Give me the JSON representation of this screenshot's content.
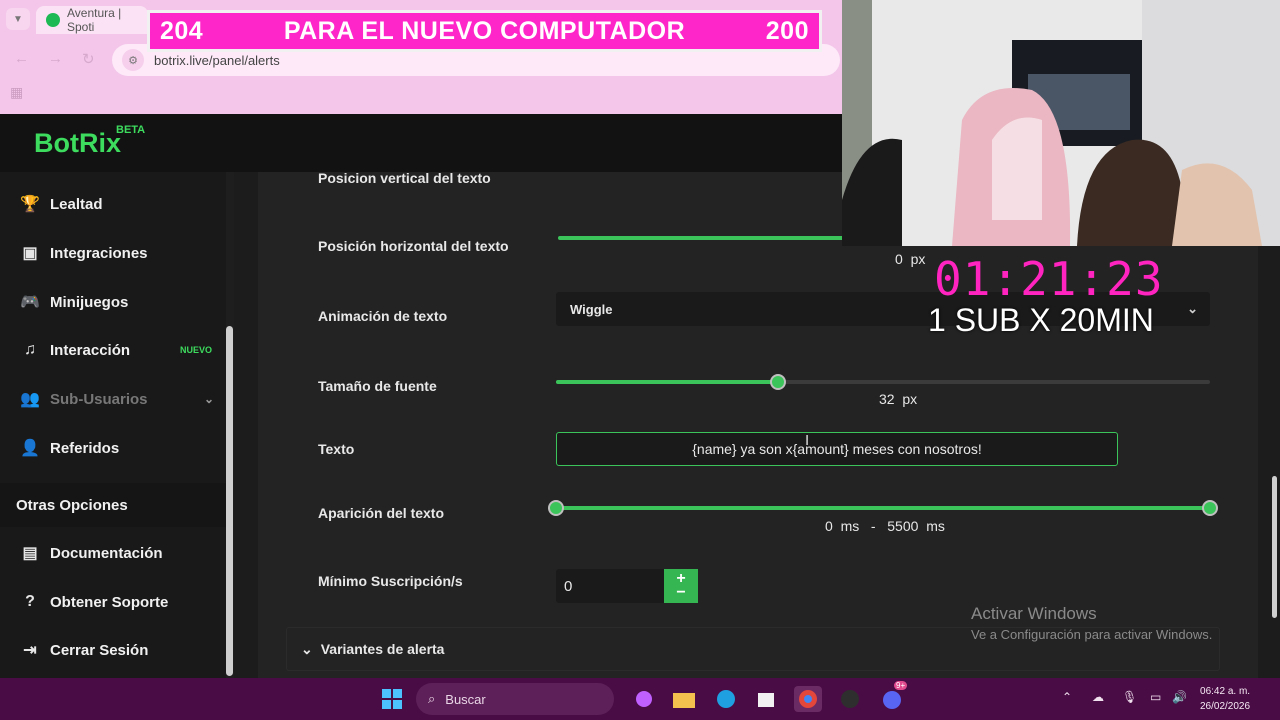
{
  "browser": {
    "tab_title": "Aventura | Spoti",
    "url": "botrix.live/panel/alerts"
  },
  "goal_banner": {
    "left_count": "204",
    "title": "PARA EL NUEVO COMPUTADOR",
    "right_count": "200"
  },
  "app": {
    "logo": "BotRix",
    "beta": "BETA"
  },
  "sidebar": {
    "items": [
      {
        "label": "Lealtad",
        "icon": "trophy-icon"
      },
      {
        "label": "Integraciones",
        "icon": "integrations-icon"
      },
      {
        "label": "Minijuegos",
        "icon": "gamepad-icon"
      },
      {
        "label": "Interacción",
        "icon": "music-note-icon",
        "badge": "NUEVO"
      },
      {
        "label": "Sub-Usuarios",
        "icon": "users-icon"
      },
      {
        "label": "Referidos",
        "icon": "referrals-icon"
      }
    ],
    "section": "Otras Opciones",
    "other_items": [
      {
        "label": "Documentación",
        "icon": "book-icon"
      },
      {
        "label": "Obtener Soporte",
        "icon": "help-icon"
      },
      {
        "label": "Cerrar Sesión",
        "icon": "logout-icon"
      }
    ]
  },
  "form": {
    "vertical_position_label": "Posicion vertical del texto",
    "horizontal_position_label": "Posición horizontal del texto",
    "horizontal_value": "0",
    "px_unit": "px",
    "animation_label": "Animación de texto",
    "animation_value": "Wiggle",
    "font_size_label": "Tamaño de fuente",
    "font_size_value": "32",
    "font_size_fraction": 0.34,
    "text_label": "Texto",
    "text_value": "{name} ya son x{amount} meses con nosotros!",
    "appearance_label": "Aparición del texto",
    "appearance_min": "0",
    "appearance_max": "5500",
    "ms_unit": "ms",
    "range_sep": "-",
    "min_sub_label": "Mínimo Suscripción/s",
    "min_sub_value": "0",
    "variants_label": "Variantes de alerta"
  },
  "overlay": {
    "timer": "01:21:23",
    "sub_rate": "1 SUB X 20MIN",
    "activate_title": "Activar Windows",
    "activate_sub": "Ve a Configuración para activar Windows."
  },
  "taskbar": {
    "search": "Buscar",
    "time": "06:42 a. m.",
    "date": "26/02/2026",
    "notification_count": "9+"
  },
  "colors": {
    "accent": "#3bc45a",
    "banner": "#ff26c9",
    "timer": "#ff24c0",
    "taskbar": "#4a0c45"
  }
}
